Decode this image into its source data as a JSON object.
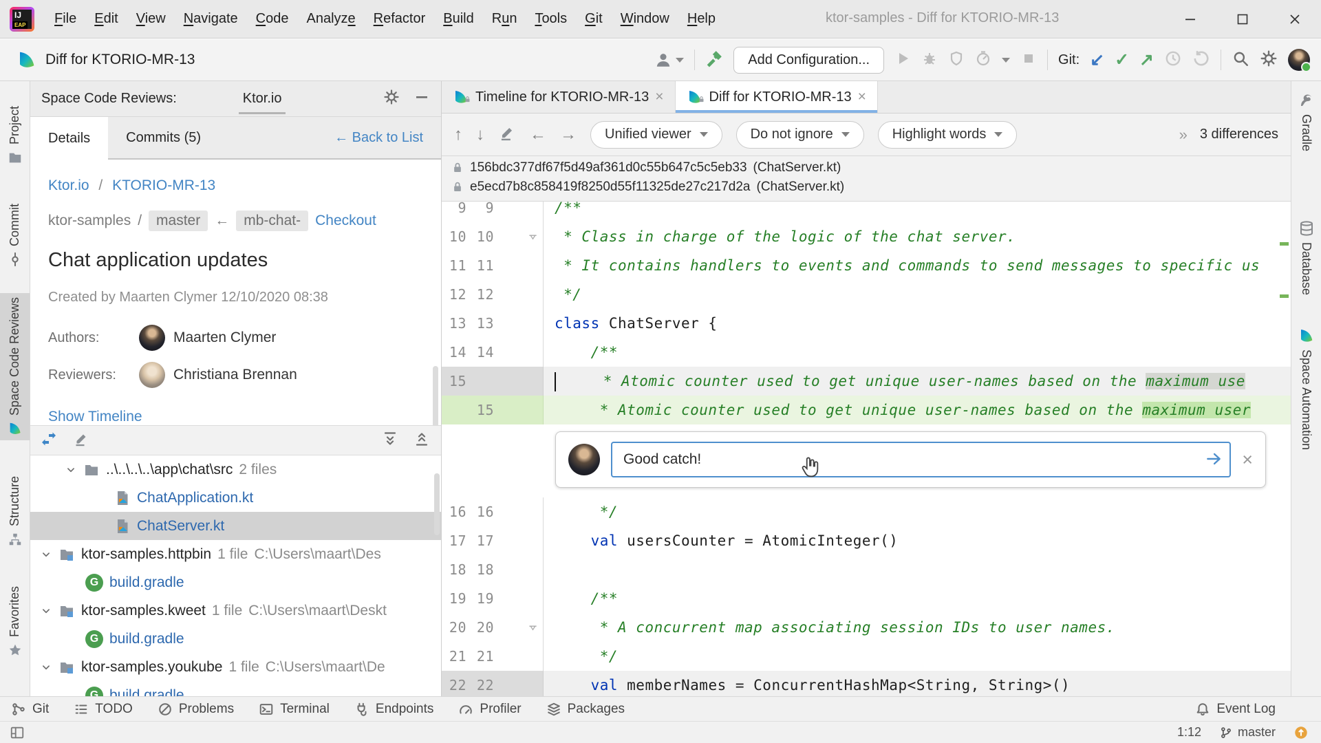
{
  "window": {
    "title": "ktor-samples - Diff for KTORIO-MR-13",
    "controls": [
      {
        "name": "minimize"
      },
      {
        "name": "maximize"
      },
      {
        "name": "close"
      }
    ]
  },
  "menu_bar": {
    "items": [
      {
        "label": "File",
        "mnemonic": 0
      },
      {
        "label": "Edit",
        "mnemonic": 0
      },
      {
        "label": "View",
        "mnemonic": 0
      },
      {
        "label": "Navigate",
        "mnemonic": 0
      },
      {
        "label": "Code",
        "mnemonic": 0
      },
      {
        "label": "Analyze",
        "mnemonic": 6
      },
      {
        "label": "Refactor",
        "mnemonic": 0
      },
      {
        "label": "Build",
        "mnemonic": 0
      },
      {
        "label": "Run",
        "mnemonic": 1
      },
      {
        "label": "Tools",
        "mnemonic": 0
      },
      {
        "label": "Git",
        "mnemonic": 0
      },
      {
        "label": "Window",
        "mnemonic": 0
      },
      {
        "label": "Help",
        "mnemonic": 0
      }
    ]
  },
  "toolbar": {
    "doc_title": "Diff for KTORIO-MR-13",
    "add_configuration": "Add Configuration...",
    "git_label": "Git:",
    "left_icons": [
      "user-silhouette",
      "hammer"
    ],
    "run_icons": [
      "run",
      "debug",
      "coverage",
      "profile",
      "dropdown",
      "stop"
    ],
    "git_icons": [
      "update-project",
      "commit-changes",
      "push",
      "history",
      "rollback"
    ],
    "right_icons": [
      "search",
      "gear",
      "avatar"
    ]
  },
  "left_stripe": [
    {
      "label": "Project",
      "icon": "folder",
      "selected": false
    },
    {
      "label": "Commit",
      "icon": "commit-node",
      "selected": false
    },
    {
      "label": "Space Code Reviews",
      "icon": "space-logo",
      "selected": true
    },
    {
      "label": "Structure",
      "icon": "structure",
      "selected": false
    },
    {
      "label": "Favorites",
      "icon": "favorites",
      "selected": false
    }
  ],
  "right_stripe": [
    {
      "label": "Gradle",
      "icon": "gradle-elephant"
    },
    {
      "label": "Database",
      "icon": "database"
    },
    {
      "label": "Space Automation",
      "icon": "space-logo"
    }
  ],
  "review_panel": {
    "header_title": "Space Code Reviews:",
    "project_tab": "Ktor.io",
    "header_icons": [
      "gear",
      "minimize-panel"
    ],
    "tabs": [
      {
        "label": "Details",
        "selected": true
      },
      {
        "label": "Commits (5)",
        "selected": false
      }
    ],
    "back_link": "← Back to List",
    "breadcrumb": {
      "project": "Ktor.io",
      "sep": "/",
      "review": "KTORIO-MR-13"
    },
    "branch_row": {
      "repo": "ktor-samples",
      "sep": "/",
      "target_branch": "master",
      "arrow": "←",
      "source_branch": "mb-chat-",
      "checkout_link": "Checkout"
    },
    "title": "Chat application updates",
    "created": "Created by Maarten Clymer 12/10/2020 08:38",
    "authors_label": "Authors:",
    "author_name": "Maarten Clymer",
    "reviewers_label": "Reviewers:",
    "reviewer_name": "Christiana Brennan",
    "show_timeline": "Show Timeline",
    "tree_toolbar_icons": [
      "compare-arrows",
      "edit",
      "expand-all",
      "collapse-all"
    ],
    "tree": [
      {
        "type": "dir",
        "icon": "folder",
        "chevron": true,
        "name": "..\\..\\..\\..\\app\\chat\\src",
        "meta": "2 files"
      },
      {
        "type": "kfile",
        "icon": "kotlin-file",
        "name": "ChatApplication.kt"
      },
      {
        "type": "kfile",
        "icon": "kotlin-file",
        "name": "ChatServer.kt",
        "selected": true
      },
      {
        "type": "module",
        "icon": "module-folder",
        "chevron": true,
        "name": "ktor-samples.httpbin",
        "meta": "1 file",
        "path": "C:\\Users\\maart\\Des"
      },
      {
        "type": "gfile",
        "icon": "gradle-file",
        "name": "build.gradle"
      },
      {
        "type": "module",
        "icon": "module-folder",
        "chevron": true,
        "name": "ktor-samples.kweet",
        "meta": "1 file",
        "path": "C:\\Users\\maart\\Deskt"
      },
      {
        "type": "gfile",
        "icon": "gradle-file",
        "name": "build.gradle"
      },
      {
        "type": "module",
        "icon": "module-folder",
        "chevron": true,
        "name": "ktor-samples.youkube",
        "meta": "1 file",
        "path": "C:\\Users\\maart\\De"
      },
      {
        "type": "gfile",
        "icon": "gradle-file",
        "name": "build.gradle"
      }
    ]
  },
  "editor": {
    "tabs": [
      {
        "label": "Timeline for KTORIO-MR-13",
        "icon": "space-logo",
        "badge": "lock",
        "selected": false
      },
      {
        "label": "Diff for KTORIO-MR-13",
        "icon": "space-logo",
        "badge": "lock",
        "selected": true
      }
    ],
    "diff_toolbar": {
      "nav_icons": [
        "arrow-up",
        "arrow-down",
        "edit",
        "arrow-left",
        "arrow-right"
      ],
      "viewer_select": "Unified viewer",
      "ignore_select": "Do not ignore",
      "highlight_select": "Highlight words",
      "overflow_glyph": "»",
      "differences": "3 differences"
    },
    "commits": [
      {
        "icon": "lock",
        "hash": "156bdc377df67f5d49af361d0c55b647c5c5eb33",
        "file": "(ChatServer.kt)"
      },
      {
        "icon": "lock",
        "hash": "e5ecd7b8c858419f8250d55f11325de27c217d2a",
        "file": "(ChatServer.kt)"
      }
    ],
    "code": {
      "lines": [
        {
          "old": "9",
          "new": "9",
          "kind": "ctx",
          "first": true,
          "segments": [
            {
              "t": "/**",
              "c": "cmt"
            }
          ]
        },
        {
          "old": "10",
          "new": "10",
          "kind": "ctx",
          "fold": true,
          "segments": [
            {
              "t": " * Class in charge of the logic of the chat server.",
              "c": "cmt"
            }
          ]
        },
        {
          "old": "11",
          "new": "11",
          "kind": "ctx",
          "segments": [
            {
              "t": " * It contains handlers to events and commands to send messages to specific us",
              "c": "cmt"
            }
          ]
        },
        {
          "old": "12",
          "new": "12",
          "kind": "ctx",
          "segments": [
            {
              "t": " */",
              "c": "cmt"
            }
          ]
        },
        {
          "old": "13",
          "new": "13",
          "kind": "ctx",
          "segments": [
            {
              "t": "class",
              "c": "kw"
            },
            {
              "t": " ChatServer {",
              "c": "pl"
            }
          ]
        },
        {
          "old": "14",
          "new": "14",
          "kind": "ctx",
          "segments": [
            {
              "t": "    /**",
              "c": "cmt"
            }
          ]
        },
        {
          "old": "15",
          "new": "",
          "kind": "old",
          "caret": true,
          "segments": [
            {
              "t": "     * Atomic counter used to get unique user-names based on the ",
              "c": "cmt"
            },
            {
              "t": "maximum use",
              "c": "cmt hlold"
            }
          ]
        },
        {
          "old": "",
          "new": "15",
          "kind": "new",
          "segments": [
            {
              "t": "     * Atomic counter used to get unique user-names based on the ",
              "c": "cmt"
            },
            {
              "t": "maximum user",
              "c": "cmt hlnew"
            }
          ]
        },
        {
          "kind": "comment"
        },
        {
          "old": "16",
          "new": "16",
          "kind": "ctx",
          "segments": [
            {
              "t": "     */",
              "c": "cmt"
            }
          ]
        },
        {
          "old": "17",
          "new": "17",
          "kind": "ctx",
          "segments": [
            {
              "t": "    ",
              "c": "pl"
            },
            {
              "t": "val",
              "c": "kw"
            },
            {
              "t": " usersCounter = AtomicInteger()",
              "c": "pl"
            }
          ]
        },
        {
          "old": "18",
          "new": "18",
          "kind": "ctx",
          "segments": []
        },
        {
          "old": "19",
          "new": "19",
          "kind": "ctx",
          "segments": [
            {
              "t": "    /**",
              "c": "cmt"
            }
          ]
        },
        {
          "old": "20",
          "new": "20",
          "kind": "ctx",
          "fold": true,
          "segments": [
            {
              "t": "     * A concurrent map associating session IDs to user names.",
              "c": "cmt"
            }
          ]
        },
        {
          "old": "21",
          "new": "21",
          "kind": "ctx",
          "segments": [
            {
              "t": "     */",
              "c": "cmt"
            }
          ]
        },
        {
          "old": "22",
          "new": "22",
          "kind": "old",
          "segments": [
            {
              "t": "    ",
              "c": "pl"
            },
            {
              "t": "val",
              "c": "kw"
            },
            {
              "t": " memberNames = ConcurrentHashMap<String, String>()",
              "c": "pl"
            }
          ]
        }
      ]
    },
    "comment": {
      "text": "Good catch!",
      "send_icon": "send-arrow",
      "close_icon": "close"
    }
  },
  "bottom": {
    "tool_buttons": [
      {
        "label": "Git",
        "icon": "git-graph"
      },
      {
        "label": "TODO",
        "icon": "todo-list"
      },
      {
        "label": "Problems",
        "icon": "problems"
      },
      {
        "label": "Terminal",
        "icon": "terminal"
      },
      {
        "label": "Endpoints",
        "icon": "endpoints"
      },
      {
        "label": "Profiler",
        "icon": "profiler"
      },
      {
        "label": "Packages",
        "icon": "packages"
      }
    ],
    "event_log": {
      "label": "Event Log",
      "icon": "bell"
    },
    "caret_position": "1:12",
    "branch": {
      "icon": "git-branch",
      "name": "master"
    },
    "updates_icon": "update-notification",
    "layout_icon": "tool-window-layout"
  },
  "colors": {
    "accent_blue": "#4385c4",
    "tab_underline": "#82b2e6",
    "comment_green": "#267f26",
    "keyword_blue": "#0033b3",
    "diff_new_bg": "#eaf5e0",
    "diff_old_bg": "#f0f0f0",
    "diff_word_new": "#c3e6ac",
    "git_action_green": "#59a869",
    "git_update_blue": "#3a76c2"
  }
}
